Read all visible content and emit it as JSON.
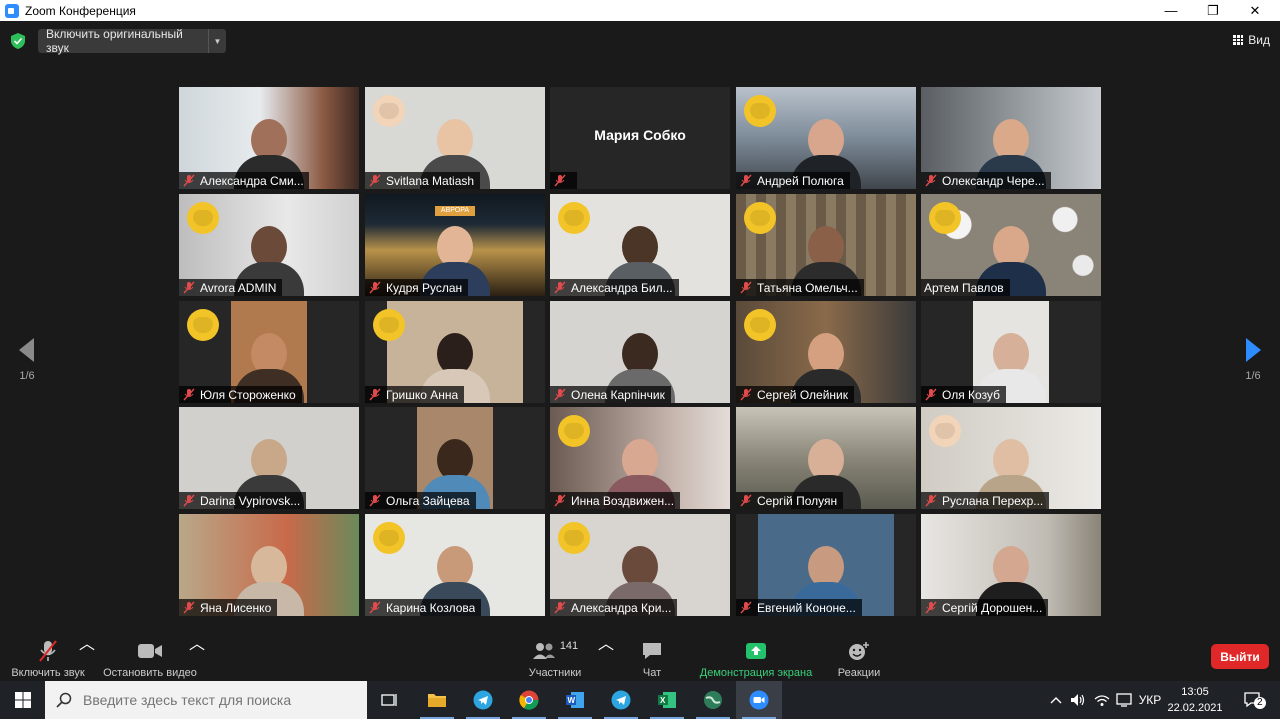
{
  "window": {
    "title": "Zoom Конференция",
    "minimize_glyph": "—",
    "maximize_glyph": "❐",
    "close_glyph": "✕"
  },
  "topbar": {
    "original_sound_label": "Включить оригинальный звук",
    "view_label": "Вид"
  },
  "pager": {
    "left": "1/6",
    "right": "1/6"
  },
  "gallery": {
    "row1": [
      "Александра Сми...",
      "Svitlana Matiash",
      "",
      "Андрей Полюга",
      "Олександр Чере..."
    ],
    "row1_center_name": "Мария Собко",
    "row2": [
      "Avrora ADMIN",
      "Кудря Руслан",
      "Александра Бил...",
      "Татьяна Омельч...",
      "Артем Павлов"
    ],
    "row3": [
      "Юля Стороженко",
      "Гришко Анна",
      "Олена Карпінчик",
      "Сергей Олейник",
      "Оля Козуб"
    ],
    "row4": [
      "Darina Vypirovsk...",
      "Ольга Зайцева",
      "Инна Воздвижен...",
      "Сергій Полуян",
      "Руслана Перехр..."
    ],
    "row5": [
      "Яна Лисенко",
      "Карина Козлова",
      "Александра Кри...",
      "Евгений Кононе...",
      "Сергій Дорошен..."
    ],
    "shop_sign": "АВРОРА"
  },
  "toolbar": {
    "unmute_label": "Включить звук",
    "video_label": "Остановить видео",
    "participants_label": "Участники",
    "participants_count": "141",
    "chat_label": "Чат",
    "share_label": "Демонстрация экрана",
    "reactions_label": "Реакции",
    "leave_label": "Выйти"
  },
  "taskbar": {
    "search_placeholder": "Введите здесь текст для поиска",
    "lang": "УКР",
    "time": "13:05",
    "date": "22.02.2021",
    "notifications": "2"
  },
  "colors": {
    "accent_blue": "#2d8cff",
    "share_green": "#24c26a",
    "leave_red": "#e02828",
    "active_speaker": "#e8f06a"
  }
}
